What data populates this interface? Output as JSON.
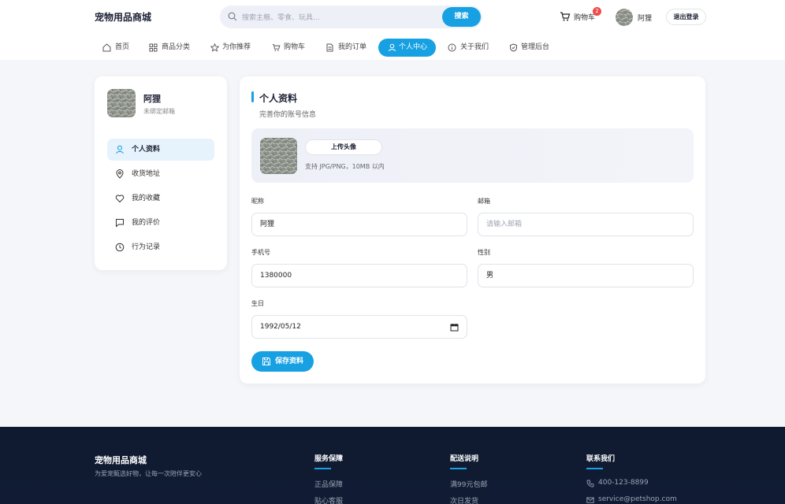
{
  "header": {
    "brand": "宠物用品商城",
    "search_placeholder": "搜索主粮、零食、玩具...",
    "search_button": "搜索",
    "cart_label": "购物车",
    "cart_count": "2",
    "username": "阿狸",
    "logout_label": "退出登录"
  },
  "nav": {
    "items": [
      {
        "label": "首页",
        "icon": "home-icon"
      },
      {
        "label": "商品分类",
        "icon": "grid-icon"
      },
      {
        "label": "为你推荐",
        "icon": "star-icon"
      },
      {
        "label": "购物车",
        "icon": "cart-icon"
      },
      {
        "label": "我的订单",
        "icon": "document-icon"
      },
      {
        "label": "个人中心",
        "icon": "user-icon",
        "active": true
      },
      {
        "label": "关于我们",
        "icon": "info-icon"
      },
      {
        "label": "管理后台",
        "icon": "shield-icon"
      }
    ]
  },
  "sidebar": {
    "name": "阿狸",
    "email_status": "未绑定邮箱",
    "items": [
      {
        "label": "个人资料",
        "icon": "user-icon",
        "active": true
      },
      {
        "label": "收货地址",
        "icon": "location-pin-icon"
      },
      {
        "label": "我的收藏",
        "icon": "heart-icon"
      },
      {
        "label": "我的评价",
        "icon": "comment-icon"
      },
      {
        "label": "行为记录",
        "icon": "clock-icon"
      }
    ]
  },
  "profile": {
    "title": "个人资料",
    "subtitle": "完善你的账号信息",
    "upload_label": "上传头像",
    "upload_hint": "支持 JPG/PNG，10MB 以内",
    "fields": {
      "nickname_label": "昵称",
      "nickname_value": "阿狸",
      "email_label": "邮箱",
      "email_placeholder": "请输入邮箱",
      "phone_label": "手机号",
      "phone_value": "1380000",
      "gender_label": "性别",
      "gender_value": "男",
      "birthday_label": "生日",
      "birthday_value": "1992/05/12"
    },
    "save_label": "保存资料"
  },
  "footer": {
    "brand": "宠物用品商城",
    "tagline": "为爱宠甄选好物，让每一次陪伴更安心",
    "service": {
      "title": "服务保障",
      "items": [
        "正品保障",
        "贴心客服"
      ]
    },
    "delivery": {
      "title": "配送说明",
      "items": [
        "满99元包邮",
        "次日发货"
      ]
    },
    "contact": {
      "title": "联系我们",
      "phone": "400-123-8899",
      "email": "service@petshop.com"
    }
  },
  "colors": {
    "accent": "#18a1e2",
    "badge": "#ef4a4a",
    "footer_bg": "#0f1a30"
  }
}
